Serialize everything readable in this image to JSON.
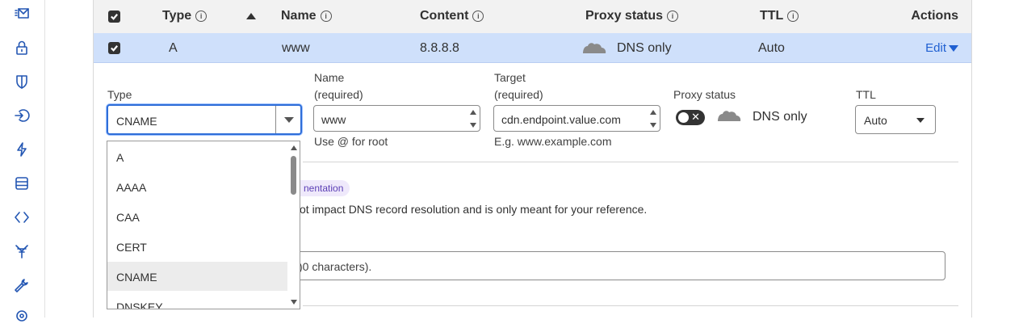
{
  "sidebar": {
    "icons": [
      "mail-icon",
      "lock-icon",
      "shield-icon",
      "login-icon",
      "bolt-icon",
      "storage-icon",
      "code-icon",
      "filter-icon",
      "wrench-icon",
      "location-icon"
    ]
  },
  "table": {
    "headers": {
      "type": "Type",
      "name": "Name",
      "content": "Content",
      "proxy_status": "Proxy status",
      "ttl": "TTL",
      "actions": "Actions"
    },
    "row": {
      "type": "A",
      "name": "www",
      "content": "8.8.8.8",
      "proxy_status": "DNS only",
      "ttl": "Auto",
      "edit_label": "Edit"
    }
  },
  "form": {
    "type": {
      "label": "Type",
      "value": "CNAME"
    },
    "name": {
      "label_line1": "Name",
      "label_line2": "(required)",
      "value": "www",
      "hint": "Use @ for root"
    },
    "target": {
      "label_line1": "Target",
      "label_line2": "(required)",
      "value": "cdn.endpoint.value.com",
      "hint": "E.g. www.example.com"
    },
    "proxy": {
      "label": "Proxy status",
      "value_text": "DNS only",
      "toggle_symbol": "✕"
    },
    "ttl": {
      "label": "TTL",
      "value": "Auto"
    },
    "doc_badge": "nentation",
    "note_text": "ot impact DNS record resolution and is only meant for your reference.",
    "comment_placeholder": ")0 characters)."
  },
  "type_dropdown": {
    "options": [
      "A",
      "AAAA",
      "CAA",
      "CERT",
      "CNAME",
      "DNSKEY"
    ],
    "selected": "CNAME"
  },
  "colors": {
    "accent": "#2f6ed8",
    "row_highlight": "#cfe0fb",
    "link": "#1f5fd1",
    "badge_bg": "#efe9fb"
  }
}
